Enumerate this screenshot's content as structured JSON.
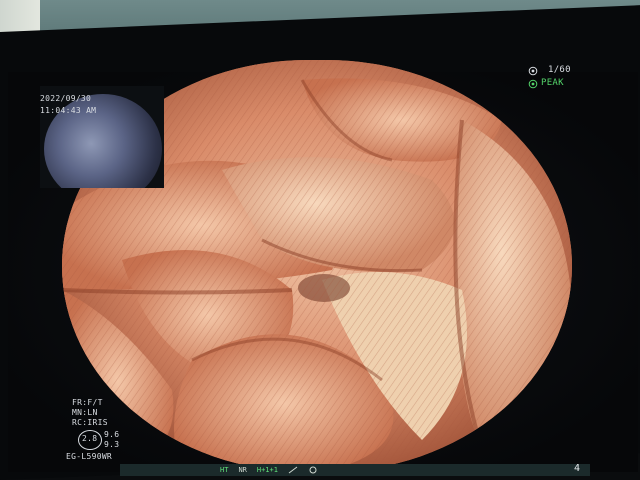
{
  "osd": {
    "date": "2022/09/30",
    "time": "11:04:43",
    "time_suffix": "AM",
    "frame_counter": "1/60",
    "mode": "PEAK",
    "fr": "FR:F/T",
    "mn": "MN:LN",
    "rc": "RC:IRIS",
    "iris_value": "2.8",
    "val_a": "9.6",
    "val_b": "9.3",
    "model": "EG-L590WR",
    "page_number": "4"
  },
  "status_bar": {
    "ht_label": "HT",
    "nr_label": "NR",
    "zoom_label": "H+1+1"
  },
  "colors": {
    "mucosa_base": "#c56f4f",
    "mucosa_light": "#e8a58a",
    "osd_text": "#d9dde2",
    "osd_green": "#54d46a"
  },
  "icons": [
    "camera-icon",
    "recording-icon",
    "zoom-icon",
    "capture-icon"
  ]
}
